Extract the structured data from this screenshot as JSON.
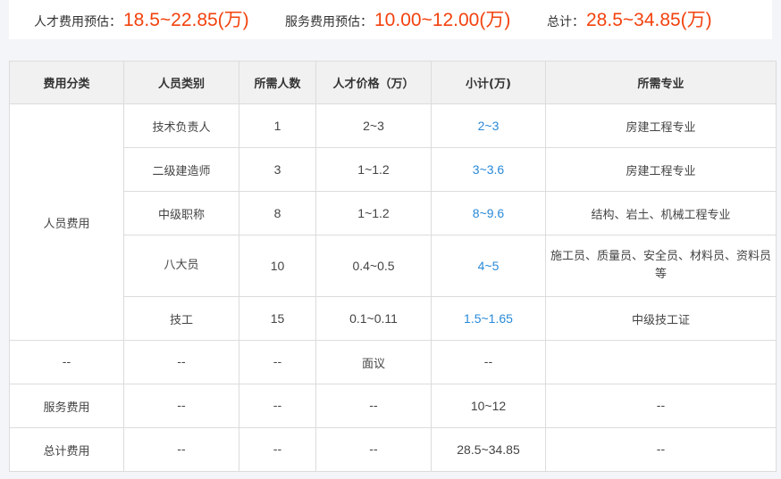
{
  "summary": {
    "talent_label": "人才费用预估：",
    "talent_value": "18.5~22.85(万)",
    "service_label": "服务费用预估：",
    "service_value": "10.00~12.00(万)",
    "total_label": "总计：",
    "total_value": "28.5~34.85(万)",
    "value_color": "#f2420e"
  },
  "table": {
    "headers": [
      "费用分类",
      "人员类别",
      "所需人数",
      "人才价格（万）",
      "小计(万)",
      "所需专业"
    ],
    "personnel_category": "人员费用",
    "personnel_rows": [
      {
        "type": "技术负责人",
        "count": "1",
        "price": "2~3",
        "subtotal": "2~3",
        "major": "房建工程专业"
      },
      {
        "type": "二级建造师",
        "count": "3",
        "price": "1~1.2",
        "subtotal": "3~3.6",
        "major": "房建工程专业"
      },
      {
        "type": "中级职称",
        "count": "8",
        "price": "1~1.2",
        "subtotal": "8~9.6",
        "major": "结构、岩土、机械工程专业"
      },
      {
        "type": "八大员",
        "count": "10",
        "price": "0.4~0.5",
        "subtotal": "4~5",
        "major": "施工员、质量员、安全员、材料员、资料员等"
      },
      {
        "type": "技工",
        "count": "15",
        "price": "0.1~0.11",
        "subtotal": "1.5~1.65",
        "major": "中级技工证"
      }
    ],
    "other_rows": [
      {
        "category": "--",
        "type": "--",
        "count": "--",
        "price": "面议",
        "subtotal": "--",
        "major": ""
      },
      {
        "category": "服务费用",
        "type": "--",
        "count": "--",
        "price": "--",
        "subtotal": "10~12",
        "major": "--"
      },
      {
        "category": "总计费用",
        "type": "--",
        "count": "--",
        "price": "--",
        "subtotal": "28.5~34.85",
        "major": "--"
      }
    ],
    "subtotal_color": "#2a8ad8"
  }
}
